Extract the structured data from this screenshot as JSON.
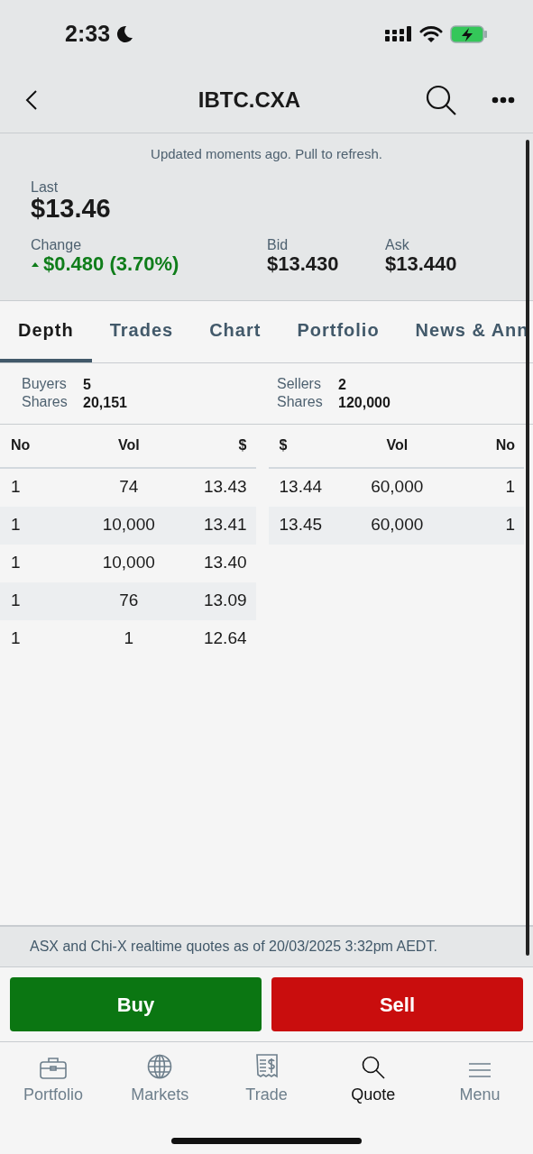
{
  "status_bar": {
    "time": "2:33"
  },
  "header": {
    "title": "IBTC.CXA"
  },
  "summary": {
    "updated": "Updated moments ago. Pull to refresh.",
    "last_label": "Last",
    "last": "$13.46",
    "change_label": "Change",
    "change": {
      "text": "$0.480 (3.70%)",
      "kind": "up"
    },
    "bid_label": "Bid",
    "bid": "$13.430",
    "ask_label": "Ask",
    "ask": "$13.440"
  },
  "tabs": [
    {
      "label": "Depth",
      "selected": true
    },
    {
      "label": "Trades",
      "selected": false
    },
    {
      "label": "Chart",
      "selected": false
    },
    {
      "label": "Portfolio",
      "selected": false
    },
    {
      "label": "News & Ann",
      "selected": false
    }
  ],
  "buyers": {
    "count_label": "Buyers",
    "count": "5",
    "shares_label": "Shares",
    "shares": "20,151"
  },
  "sellers": {
    "count_label": "Sellers",
    "count": "2",
    "shares_label": "Shares",
    "shares": "120,000"
  },
  "bids": {
    "columns": [
      "No",
      "Vol",
      "$"
    ],
    "rows": [
      [
        "1",
        "74",
        "13.43"
      ],
      [
        "1",
        "10,000",
        "13.41"
      ],
      [
        "1",
        "10,000",
        "13.40"
      ],
      [
        "1",
        "76",
        "13.09"
      ],
      [
        "1",
        "1",
        "12.64"
      ]
    ]
  },
  "asks": {
    "columns": [
      "$",
      "Vol",
      "No"
    ],
    "rows": [
      [
        "13.44",
        "60,000",
        "1"
      ],
      [
        "13.45",
        "60,000",
        "1"
      ]
    ]
  },
  "footer": "ASX and Chi-X realtime quotes as of 20/03/2025 3:32pm AEDT.",
  "buttons": [
    {
      "label": "Buy",
      "kind": "buy"
    },
    {
      "label": "Sell",
      "kind": "sell"
    }
  ],
  "nav": [
    {
      "label": "Portfolio",
      "kind": "briefcase",
      "selected": false
    },
    {
      "label": "Markets",
      "kind": "globe",
      "selected": false
    },
    {
      "label": "Trade",
      "kind": "receipt",
      "selected": false
    },
    {
      "label": "Quote",
      "kind": "search",
      "selected": true
    },
    {
      "label": "Menu",
      "kind": "menu",
      "selected": false
    }
  ]
}
